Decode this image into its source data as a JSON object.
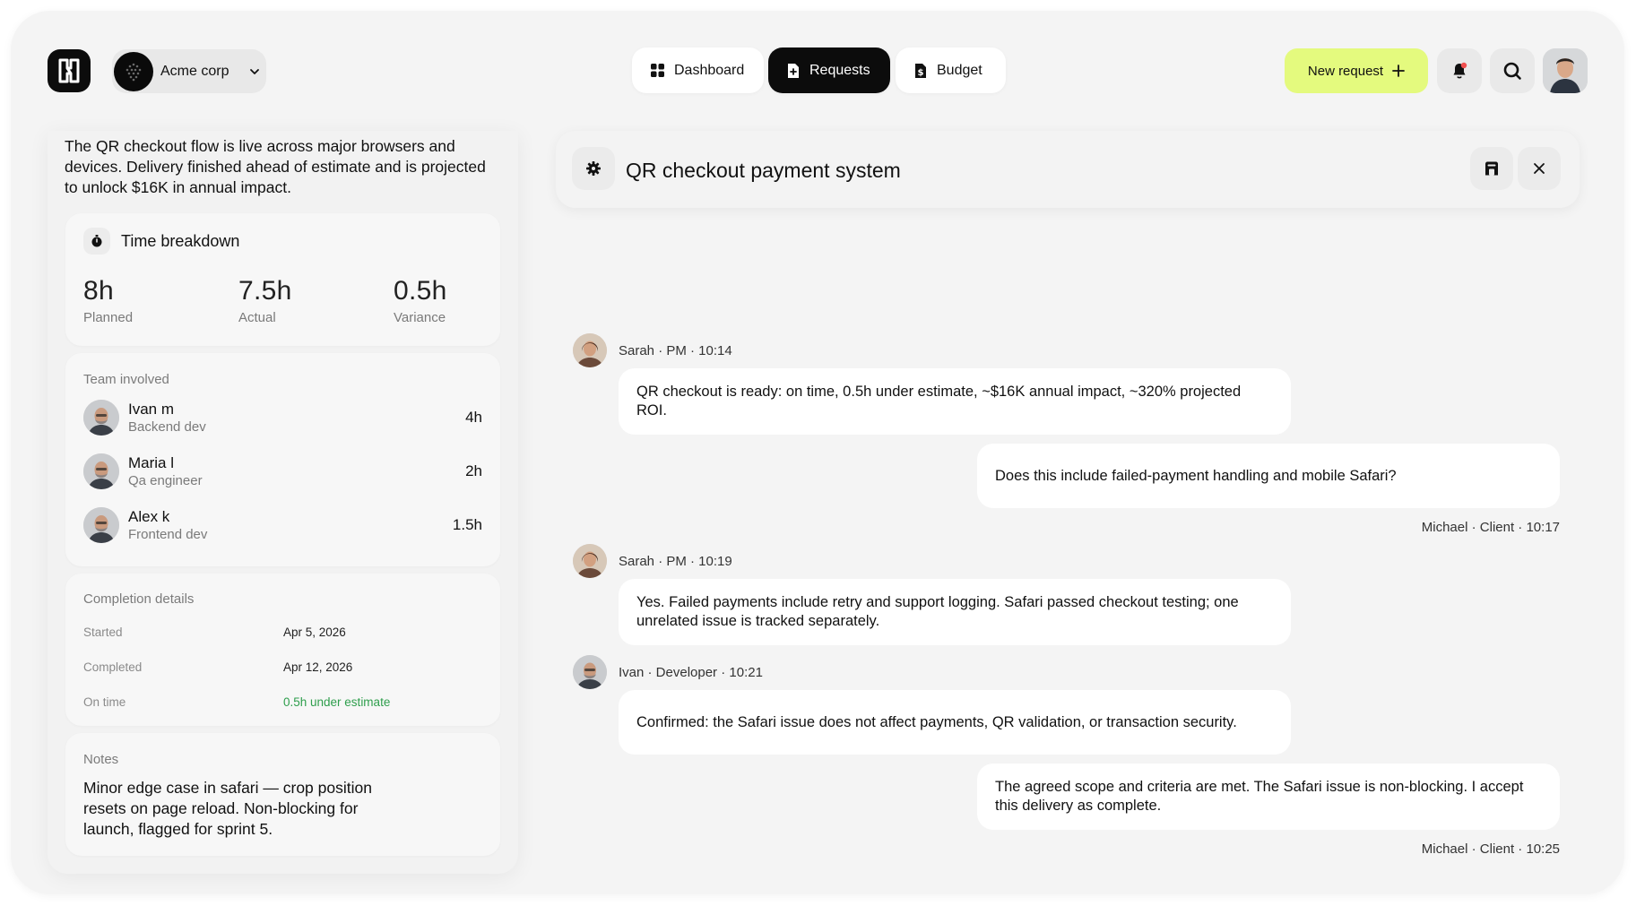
{
  "header": {
    "org": {
      "name": "Acme corp"
    },
    "nav": [
      {
        "label": "Dashboard",
        "icon": "grid-icon",
        "active": false
      },
      {
        "label": "Requests",
        "icon": "document-icon",
        "active": true
      },
      {
        "label": "Budget",
        "icon": "dollar-document-icon",
        "active": false
      }
    ],
    "new_request_label": "New request",
    "accent_color": "#e4fa7e"
  },
  "left_panel": {
    "summary": "The QR checkout flow is live across major browsers and devices. Delivery finished ahead of estimate and is projected to unlock $16K in annual impact.",
    "time_breakdown": {
      "title": "Time breakdown",
      "stats": [
        {
          "value": "8h",
          "label": "Planned"
        },
        {
          "value": "7.5h",
          "label": "Actual"
        },
        {
          "value": "0.5h",
          "label": "Variance"
        }
      ]
    },
    "team": {
      "title": "Team involved",
      "members": [
        {
          "name": "Ivan m",
          "role": "Backend dev",
          "hours": "4h"
        },
        {
          "name": "Maria l",
          "role": "Qa engineer",
          "hours": "2h"
        },
        {
          "name": "Alex k",
          "role": "Frontend dev",
          "hours": "1.5h"
        }
      ]
    },
    "completion": {
      "title": "Completion details",
      "rows": [
        {
          "key": "Started",
          "value": "Apr 5, 2026"
        },
        {
          "key": "Completed",
          "value": "Apr 12, 2026"
        },
        {
          "key": "On time",
          "value": "0.5h under estimate"
        }
      ]
    },
    "notes": {
      "title": "Notes",
      "text": "Minor edge case in safari — crop position resets on page reload. Non-blocking for launch, flagged for sprint 5."
    }
  },
  "request": {
    "title": "QR checkout payment system"
  },
  "messages": [
    {
      "meta": "Sarah · PM · 10:14",
      "text": "QR checkout is ready: on time, 0.5h under estimate, ~$16K annual impact, ~320% projected ROI."
    },
    {
      "meta": "Michael · Client · 10:17",
      "text": "Does this include failed-payment handling and mobile Safari?"
    },
    {
      "meta": "Sarah · PM · 10:19",
      "text": "Yes. Failed payments include retry and support logging. Safari passed checkout testing; one unrelated issue is tracked separately."
    },
    {
      "meta": "Ivan · Developer · 10:21",
      "text": "Confirmed: the Safari issue does not affect payments, QR validation, or transaction security."
    },
    {
      "meta": "Michael · Client · 10:25",
      "text": "The agreed scope and criteria are met. The Safari issue is non-blocking. I accept this delivery as complete."
    }
  ]
}
